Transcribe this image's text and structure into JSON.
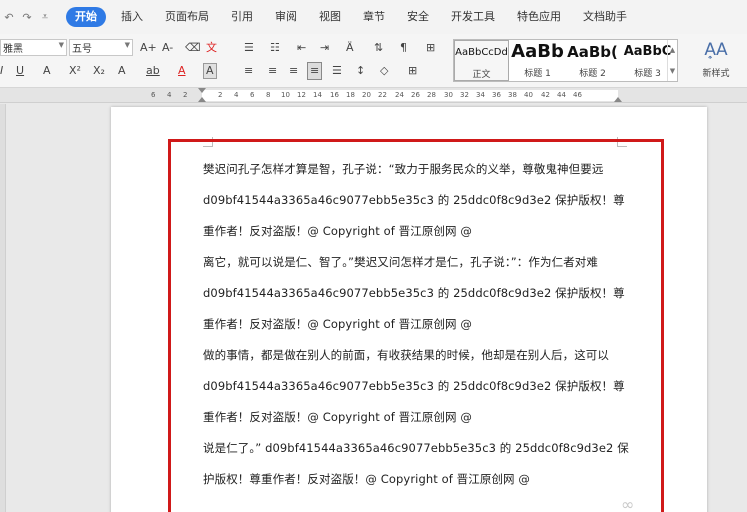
{
  "quick_access": [
    "undo-icon",
    "redo-icon",
    "customize-icon"
  ],
  "menu": {
    "active": "开始",
    "tabs": [
      "插入",
      "页面布局",
      "引用",
      "审阅",
      "视图",
      "章节",
      "安全",
      "开发工具",
      "特色应用",
      "文档助手"
    ]
  },
  "ribbon": {
    "font_name": "雅黑",
    "font_size": "五号",
    "grow_font": "A+",
    "shrink_font": "A-",
    "clear_format": "⌫",
    "phonetic": "文",
    "bold": "B",
    "italic": "I",
    "underline": "U",
    "font_color": "A",
    "superscript": "X²",
    "subscript": "X₂",
    "text_effect": "A",
    "highlight": "ab",
    "char_shade": "A",
    "new_style_label": "新样式",
    "styles": [
      {
        "sample": "AaBbCcDd",
        "caption": "正文"
      },
      {
        "sample": "AaBb",
        "caption": "标题 1"
      },
      {
        "sample": "AaBb(",
        "caption": "标题 2"
      },
      {
        "sample": "AaBbC",
        "caption": "标题 3"
      }
    ]
  },
  "ruler": {
    "numbers": [
      "6",
      "4",
      "2",
      "2",
      "4",
      "6",
      "8",
      "10",
      "12",
      "14",
      "16",
      "18",
      "20",
      "22",
      "24",
      "26",
      "28",
      "30",
      "32",
      "34",
      "36",
      "38",
      "40",
      "42",
      "44",
      "46"
    ]
  },
  "document": {
    "lines": [
      "樊迟问孔子怎样才算是智，孔子说：“致力于服务民众的义举，尊敬鬼神但要远",
      "d09bf41544a3365a46c9077ebb5e35c3 的 25ddc0f8c9d3e2  保护版权！尊",
      "重作者！反对盗版！@ Copyright of  晋江原创网  @",
      "离它，就可以说是仁、智了。”樊迟又问怎样才是仁，孔子说：”：作为仁者对难",
      "d09bf41544a3365a46c9077ebb5e35c3 的 25ddc0f8c9d3e2  保护版权！尊",
      "重作者！反对盗版！@ Copyright of  晋江原创网  @",
      "做的事情，都是做在别人的前面，有收获结果的时候，他却是在别人后，这可以",
      "d09bf41544a3365a46c9077ebb5e35c3 的 25ddc0f8c9d3e2  保护版权！尊",
      "重作者！反对盗版！@ Copyright of  晋江原创网  @",
      "说是仁了。” d09bf41544a3365a46c9077ebb5e35c3 的 25ddc0f8c9d3e2  保",
      "护版权！尊重作者！反对盗版！@ Copyright of  晋江原创网  @"
    ]
  }
}
